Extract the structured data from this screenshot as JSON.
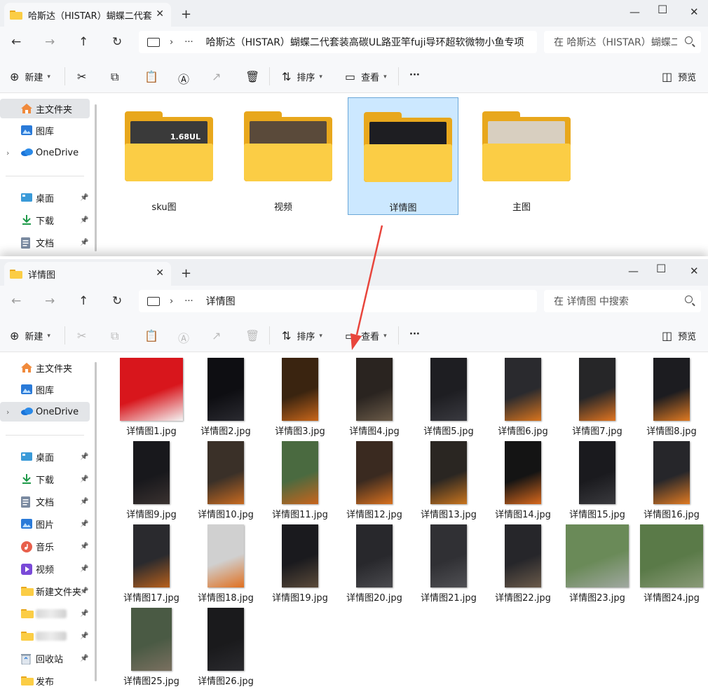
{
  "window1": {
    "tab_title": "哈斯达（HISTAR）蝴蝶二代套",
    "address": "哈斯达（HISTAR）蝴蝶二代套装高碳UL路亚竿fuji导环超软微物小鱼专项",
    "search_placeholder": "在 哈斯达（HISTAR）蝴蝶二",
    "toolbar": {
      "new": "新建",
      "sort": "排序",
      "view": "查看",
      "more": "···",
      "preview": "预览"
    },
    "sidebar": [
      {
        "label": "主文件夹",
        "icon": "home-icon",
        "selected": true
      },
      {
        "label": "图库",
        "icon": "gallery-icon"
      },
      {
        "label": "OneDrive",
        "icon": "cloud-icon",
        "expandable": true
      },
      {
        "label": "桌面",
        "icon": "desktop-icon",
        "pinned": true
      },
      {
        "label": "下载",
        "icon": "download-icon",
        "pinned": true
      },
      {
        "label": "文档",
        "icon": "document-icon",
        "pinned": true
      }
    ],
    "folders": [
      {
        "name": "sku图",
        "paper": "#3a3a3a",
        "selected": false
      },
      {
        "name": "视频",
        "paper": "#5a4a3a",
        "selected": false
      },
      {
        "name": "详情图",
        "paper": "#1e1e22",
        "selected": true
      },
      {
        "name": "主图",
        "paper": "#d8cfc0",
        "selected": false
      }
    ],
    "sku_paper_text": "1.68UL"
  },
  "window2": {
    "tab_title": "详情图",
    "address": "详情图",
    "search_placeholder": "在 详情图 中搜索",
    "toolbar": {
      "new": "新建",
      "sort": "排序",
      "view": "查看",
      "more": "···",
      "preview": "预览"
    },
    "sidebar": [
      {
        "label": "主文件夹",
        "icon": "home-icon"
      },
      {
        "label": "图库",
        "icon": "gallery-icon"
      },
      {
        "label": "OneDrive",
        "icon": "cloud-icon",
        "selected": true,
        "expandable": true
      },
      {
        "label": "桌面",
        "icon": "desktop-icon",
        "pinned": true
      },
      {
        "label": "下载",
        "icon": "download-icon",
        "pinned": true
      },
      {
        "label": "文档",
        "icon": "document-icon",
        "pinned": true
      },
      {
        "label": "图片",
        "icon": "picture-icon",
        "pinned": true
      },
      {
        "label": "音乐",
        "icon": "music-icon",
        "pinned": true
      },
      {
        "label": "视频",
        "icon": "video-icon",
        "pinned": true
      },
      {
        "label": "新建文件夹",
        "icon": "folder-icon",
        "pinned": true
      },
      {
        "label": "",
        "icon": "folder-icon",
        "pinned": true,
        "blurred": true
      },
      {
        "label": "",
        "icon": "folder-icon",
        "pinned": true,
        "blurred": true
      },
      {
        "label": "回收站",
        "icon": "recycle-bin-icon",
        "pinned": true
      },
      {
        "label": "发布",
        "icon": "folder-icon"
      }
    ],
    "files": [
      {
        "name": "详情图1.jpg",
        "c1": "#d8161c",
        "c2": "#f4f4f4"
      },
      {
        "name": "详情图2.jpg",
        "c1": "#0e0e12",
        "c2": "#2a2a30"
      },
      {
        "name": "详情图3.jpg",
        "c1": "#3a2410",
        "c2": "#c8661a"
      },
      {
        "name": "详情图4.jpg",
        "c1": "#2a2420",
        "c2": "#6a5a48"
      },
      {
        "name": "详情图5.jpg",
        "c1": "#1e1e22",
        "c2": "#3a3a40"
      },
      {
        "name": "详情图6.jpg",
        "c1": "#2a2a2e",
        "c2": "#d8741e"
      },
      {
        "name": "详情图7.jpg",
        "c1": "#262628",
        "c2": "#e07420"
      },
      {
        "name": "详情图8.jpg",
        "c1": "#1c1c20",
        "c2": "#e07a22"
      },
      {
        "name": "详情图9.jpg",
        "c1": "#18181c",
        "c2": "#3a3230"
      },
      {
        "name": "详情图10.jpg",
        "c1": "#3a3028",
        "c2": "#c86a20"
      },
      {
        "name": "详情图11.jpg",
        "c1": "#4a6a40",
        "c2": "#c8641c"
      },
      {
        "name": "详情图12.jpg",
        "c1": "#3a2a20",
        "c2": "#d8701e"
      },
      {
        "name": "详情图13.jpg",
        "c1": "#2a2622",
        "c2": "#c8741e"
      },
      {
        "name": "详情图14.jpg",
        "c1": "#141414",
        "c2": "#d8681c"
      },
      {
        "name": "详情图15.jpg",
        "c1": "#1a1a1e",
        "c2": "#3a3a3e"
      },
      {
        "name": "详情图16.jpg",
        "c1": "#26262a",
        "c2": "#e07a22"
      },
      {
        "name": "详情图17.jpg",
        "c1": "#2a2a2e",
        "c2": "#b8601c"
      },
      {
        "name": "详情图18.jpg",
        "c1": "#d0d0d0",
        "c2": "#e07020"
      },
      {
        "name": "详情图19.jpg",
        "c1": "#1a1a1e",
        "c2": "#5a4a3a"
      },
      {
        "name": "详情图20.jpg",
        "c1": "#28282c",
        "c2": "#4a4a4e"
      },
      {
        "name": "详情图21.jpg",
        "c1": "#303034",
        "c2": "#505054"
      },
      {
        "name": "详情图22.jpg",
        "c1": "#26262a",
        "c2": "#6a5a4a"
      },
      {
        "name": "详情图23.jpg",
        "c1": "#6a8a58",
        "c2": "#a0a8a0"
      },
      {
        "name": "详情图24.jpg",
        "c1": "#5a7a48",
        "c2": "#8a9a78"
      },
      {
        "name": "详情图25.jpg",
        "c1": "#4a5a44",
        "c2": "#7a7060"
      },
      {
        "name": "详情图26.jpg",
        "c1": "#1a1a1c",
        "c2": "#2a2a2e"
      }
    ]
  }
}
